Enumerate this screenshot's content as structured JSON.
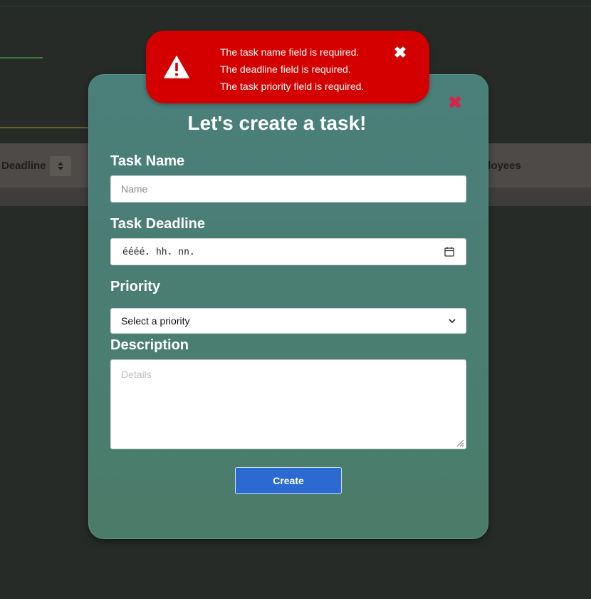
{
  "background": {
    "table": {
      "col_deadline": "Deadline",
      "col_employees": "ployees",
      "sort_icon": "sort-icon"
    }
  },
  "modal": {
    "title": "Let's create a task!",
    "close_icon": "close-icon",
    "task_name": {
      "label": "Task Name",
      "placeholder": "Name",
      "value": ""
    },
    "task_deadline": {
      "label": "Task Deadline",
      "value": "éééé. hh. nn.",
      "icon": "calendar-icon"
    },
    "priority": {
      "label": "Priority",
      "selected": "Select a priority",
      "icon": "chevron-down-icon"
    },
    "description": {
      "label": "Description",
      "placeholder": "Details"
    },
    "create_label": "Create"
  },
  "toast": {
    "icon": "warning-icon",
    "close_icon": "close-icon",
    "messages": [
      "The task name field is required.",
      "The deadline field is required.",
      "The task priority field is required."
    ]
  },
  "colors": {
    "page_bg": "#262b28",
    "modal_top": "#4a7f7b",
    "modal_bottom": "#4b7c69",
    "toast_bg": "#d40000",
    "close_accent": "#d6254b",
    "button_bg": "#2a6ad1"
  }
}
